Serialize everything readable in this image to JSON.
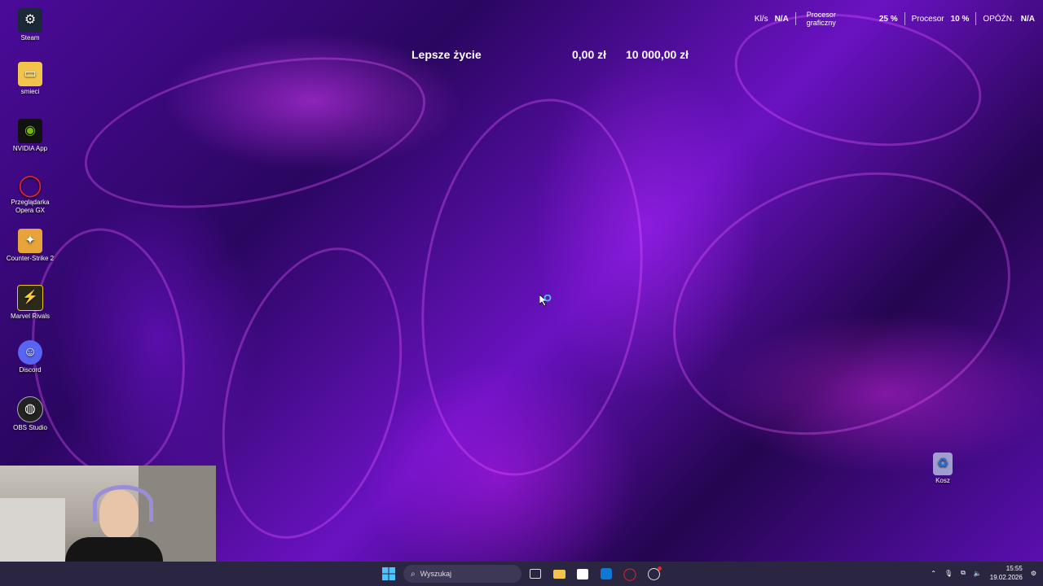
{
  "desktop_icons": [
    {
      "label": "Steam",
      "icon": "steam-icon"
    },
    {
      "label": "smieci",
      "icon": "folder-icon"
    },
    {
      "label": "NVIDIA App",
      "icon": "nvidia-icon"
    },
    {
      "label": "Przeglądarka Opera GX",
      "icon": "opera-gx-icon"
    },
    {
      "label": "Counter-Strike 2",
      "icon": "counter-strike-icon"
    },
    {
      "label": "Marvel Rivals",
      "icon": "marvel-rivals-icon"
    },
    {
      "label": "Discord",
      "icon": "discord-icon"
    },
    {
      "label": "OBS Studio",
      "icon": "obs-icon"
    }
  ],
  "recycle_bin": {
    "label": "Kosz"
  },
  "hud": {
    "fps_label": "Kl/s",
    "fps_value": "N/A",
    "gpu_label": "Procesor graficzny",
    "gpu_value": "25 %",
    "cpu_label": "Procesor",
    "cpu_value": "10 %",
    "latency_label": "OPÓŹN.",
    "latency_value": "N/A"
  },
  "goal_widget": {
    "title": "Lepsze życie",
    "current": "0,00 zł",
    "target": "10 000,00 zł"
  },
  "taskbar": {
    "search_placeholder": "Wyszukaj",
    "time": "15:55",
    "date": "19.02.2026"
  },
  "colors": {
    "wallpaper_accent": "#c82cff",
    "taskbar_bg": "#2a2540",
    "windows_blue": "#4cc2ff"
  }
}
